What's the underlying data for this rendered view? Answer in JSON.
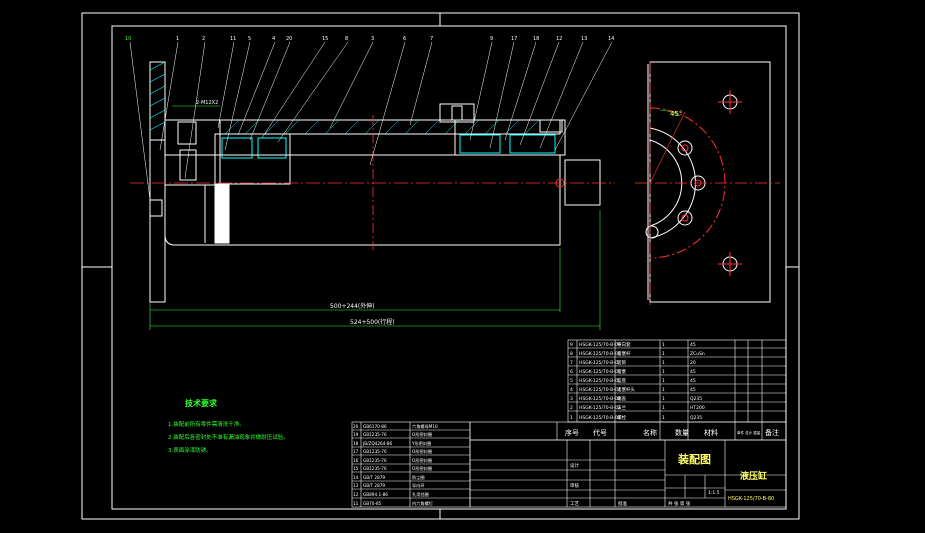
{
  "drawing": {
    "assembly_title": "装配图",
    "part_name": "液压缸",
    "drawing_number": "HSGK-125/70-B-80",
    "dimension_stroke_top": "500+244(外伸)",
    "dimension_stroke_bottom": "524+500(行程)",
    "dimension_small": "2-M12X2",
    "angle_label": "45°",
    "callouts": [
      "10",
      "1",
      "2",
      "11",
      "5",
      "4",
      "20",
      "15",
      "8",
      "3",
      "6",
      "7",
      "9",
      "17",
      "18",
      "12",
      "13",
      "14"
    ],
    "tech_requirements": {
      "heading": "技术要求",
      "items": [
        "1.装配前所有零件需清洗干净。",
        "2.装配后各密封处不准有漏油现象并做耐压试验。",
        "3.表面涂漆防锈。"
      ]
    },
    "bom_header": {
      "no": "序号",
      "code": "代号",
      "name": "名称",
      "qty": "数量",
      "material": "材料",
      "weight": "单件 总计 重量",
      "remark": "备注"
    },
    "bom_right_rows": [
      {
        "no": "9",
        "code": "HSGK-125/70-B-09",
        "name": "导向套",
        "qty": "1",
        "material": "45"
      },
      {
        "no": "8",
        "code": "HSGK-125/70-B-08",
        "name": "活塞杆",
        "qty": "1",
        "material": "ZCuSn"
      },
      {
        "no": "7",
        "code": "HSGK-125/70-B-07",
        "name": "缸筒",
        "qty": "1",
        "material": "20"
      },
      {
        "no": "6",
        "code": "HSGK-125/70-B-06",
        "name": "活塞",
        "qty": "1",
        "material": "45"
      },
      {
        "no": "5",
        "code": "HSGK-125/70-B-05",
        "name": "缸底",
        "qty": "1",
        "material": "45"
      },
      {
        "no": "4",
        "code": "HSGK-125/70-B-04",
        "name": "活塞杆头",
        "qty": "1",
        "material": "45"
      },
      {
        "no": "3",
        "code": "HSGK-125/70-B-03",
        "name": "端盖",
        "qty": "1",
        "material": "Q235"
      },
      {
        "no": "2",
        "code": "HSGK-125/70-B-02",
        "name": "法兰",
        "qty": "1",
        "material": "HT200"
      },
      {
        "no": "1",
        "code": "HSGK-125/70-B-01",
        "name": "螺栓",
        "qty": "1",
        "material": "Q235"
      }
    ],
    "bom_left_rows": [
      {
        "no": "20",
        "code": "GB6170-86",
        "name": "六角螺母M10"
      },
      {
        "no": "19",
        "code": "GB1235-76",
        "name": "O形密封圈"
      },
      {
        "no": "18",
        "code": "JB/ZQ4264-86",
        "name": "Y形密封圈"
      },
      {
        "no": "17",
        "code": "GB1235-76",
        "name": "O形密封圈"
      },
      {
        "no": "16",
        "code": "GB1235-76",
        "name": "O形密封圈"
      },
      {
        "no": "15",
        "code": "GB1235-76",
        "name": "O形密封圈"
      },
      {
        "no": "14",
        "code": "GB/T 2879",
        "name": "防尘圈"
      },
      {
        "no": "13",
        "code": "GB/T 2879",
        "name": "导向环"
      },
      {
        "no": "12",
        "code": "GB894.1-86",
        "name": "孔用挡圈"
      },
      {
        "no": "11",
        "code": "GB70-85",
        "name": "内六角螺钉"
      }
    ],
    "title_block": {
      "scale": "1:1.5",
      "sheet": "共 张 第 张",
      "design": "设计",
      "check": "审核",
      "approve": "批准",
      "process": "工艺"
    }
  }
}
